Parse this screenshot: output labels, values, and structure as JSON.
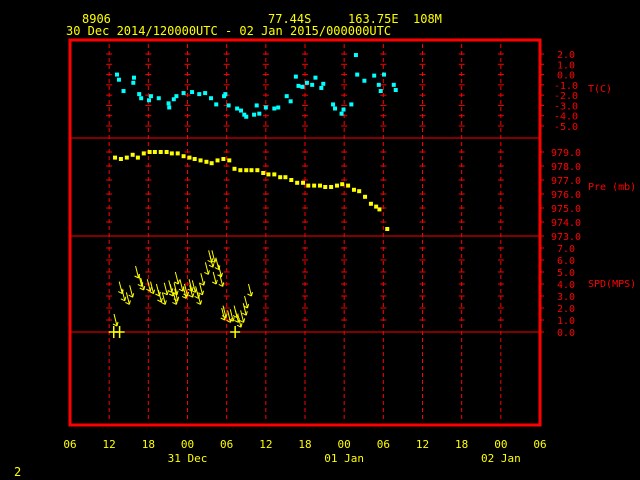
{
  "header": {
    "station_id": "8906",
    "latitude": "77.44S",
    "longitude": "163.75E",
    "elevation": "108M",
    "time_range": "30 Dec 2014/120000UTC - 02 Jan 2015/000000UTC"
  },
  "footer": {
    "page_number": "2"
  },
  "colors": {
    "frame": "#ff0000",
    "grid": "#ff0000",
    "axis_text": "#ffff00",
    "label_text": "#ff0000",
    "temperature": "#00ffff",
    "pressure": "#ffff00",
    "wind": "#ffff00"
  },
  "chart_data": {
    "type": "scatter",
    "x_axis": {
      "range_hours": [
        0,
        72
      ],
      "tick_labels": [
        "06",
        "12",
        "18",
        "00",
        "06",
        "12",
        "18",
        "00",
        "06",
        "12",
        "18",
        "00",
        "06"
      ],
      "date_labels": [
        {
          "text": "31 Dec",
          "at_hour": 18
        },
        {
          "text": "01 Jan",
          "at_hour": 42
        },
        {
          "text": "02 Jan",
          "at_hour": 66
        }
      ]
    },
    "panels": [
      {
        "name": "temperature",
        "label": "T(C)",
        "ylim": [
          -5.0,
          2.5
        ],
        "tick_labels": [
          "2.0",
          "1.0",
          "0.0",
          "-1.0",
          "-2.0",
          "-3.0",
          "-4.0",
          "-5.0"
        ],
        "tick_values": [
          2.0,
          1.0,
          0.0,
          -1.0,
          -2.0,
          -3.0,
          -4.0,
          -5.0
        ],
        "points": [
          [
            7.2,
            0.0
          ],
          [
            7.5,
            -0.5
          ],
          [
            8.2,
            -1.6
          ],
          [
            9.7,
            -0.8
          ],
          [
            9.8,
            -0.3
          ],
          [
            10.6,
            -1.9
          ],
          [
            10.9,
            -2.3
          ],
          [
            12.1,
            -2.5
          ],
          [
            12.4,
            -2.1
          ],
          [
            13.6,
            -2.3
          ],
          [
            15.1,
            -2.8
          ],
          [
            15.2,
            -3.2
          ],
          [
            15.9,
            -2.4
          ],
          [
            16.3,
            -2.1
          ],
          [
            17.4,
            -1.8
          ],
          [
            18.7,
            -1.7
          ],
          [
            19.8,
            -1.9
          ],
          [
            20.7,
            -1.8
          ],
          [
            21.6,
            -2.3
          ],
          [
            22.4,
            -2.9
          ],
          [
            23.6,
            -2.1
          ],
          [
            23.8,
            -1.9
          ],
          [
            24.3,
            -3.0
          ],
          [
            25.6,
            -3.3
          ],
          [
            26.2,
            -3.5
          ],
          [
            26.7,
            -3.9
          ],
          [
            27.0,
            -4.1
          ],
          [
            28.2,
            -3.9
          ],
          [
            28.6,
            -3.0
          ],
          [
            29.0,
            -3.8
          ],
          [
            30.0,
            -3.2
          ],
          [
            31.3,
            -3.3
          ],
          [
            31.9,
            -3.2
          ],
          [
            33.2,
            -2.1
          ],
          [
            33.8,
            -2.6
          ],
          [
            34.6,
            -0.2
          ],
          [
            35.0,
            -1.1
          ],
          [
            35.6,
            -1.2
          ],
          [
            36.3,
            -0.8
          ],
          [
            37.1,
            -1.0
          ],
          [
            37.6,
            -0.3
          ],
          [
            38.5,
            -1.3
          ],
          [
            38.8,
            -0.9
          ],
          [
            40.3,
            -2.9
          ],
          [
            40.6,
            -3.3
          ],
          [
            41.6,
            -3.8
          ],
          [
            41.9,
            -3.4
          ],
          [
            43.1,
            -2.9
          ],
          [
            43.8,
            1.9
          ],
          [
            44.0,
            0.0
          ],
          [
            45.1,
            -0.6
          ],
          [
            46.6,
            -0.1
          ],
          [
            47.3,
            -1.0
          ],
          [
            47.6,
            -1.6
          ],
          [
            48.1,
            0.0
          ],
          [
            49.6,
            -1.0
          ],
          [
            49.9,
            -1.5
          ]
        ]
      },
      {
        "name": "pressure",
        "label": "Pre (mb)",
        "ylim": [
          972.5,
          980.0
        ],
        "tick_labels": [
          "979.0",
          "978.0",
          "977.0",
          "976.0",
          "975.0",
          "974.0",
          "973.0"
        ],
        "tick_values": [
          979.0,
          978.0,
          977.0,
          976.0,
          975.0,
          974.0,
          973.0
        ],
        "points": [
          [
            6.9,
            978.6
          ],
          [
            7.8,
            978.5
          ],
          [
            8.7,
            978.6
          ],
          [
            9.6,
            978.8
          ],
          [
            10.4,
            978.6
          ],
          [
            11.3,
            978.9
          ],
          [
            12.2,
            979.0
          ],
          [
            13.0,
            979.0
          ],
          [
            13.9,
            979.0
          ],
          [
            14.8,
            979.0
          ],
          [
            15.6,
            978.9
          ],
          [
            16.5,
            978.9
          ],
          [
            17.4,
            978.7
          ],
          [
            18.3,
            978.6
          ],
          [
            19.1,
            978.5
          ],
          [
            20.0,
            978.4
          ],
          [
            20.9,
            978.3
          ],
          [
            21.7,
            978.2
          ],
          [
            22.6,
            978.4
          ],
          [
            23.5,
            978.5
          ],
          [
            24.4,
            978.4
          ],
          [
            25.2,
            977.8
          ],
          [
            26.1,
            977.7
          ],
          [
            27.0,
            977.7
          ],
          [
            27.8,
            977.7
          ],
          [
            28.7,
            977.7
          ],
          [
            29.6,
            977.5
          ],
          [
            30.4,
            977.4
          ],
          [
            31.3,
            977.4
          ],
          [
            32.2,
            977.2
          ],
          [
            33.0,
            977.2
          ],
          [
            33.9,
            977.0
          ],
          [
            34.8,
            976.8
          ],
          [
            35.7,
            976.8
          ],
          [
            36.5,
            976.6
          ],
          [
            37.4,
            976.6
          ],
          [
            38.3,
            976.6
          ],
          [
            39.1,
            976.5
          ],
          [
            40.0,
            976.5
          ],
          [
            40.9,
            976.6
          ],
          [
            41.7,
            976.7
          ],
          [
            42.6,
            976.6
          ],
          [
            43.5,
            976.3
          ],
          [
            44.3,
            976.2
          ],
          [
            45.2,
            975.8
          ],
          [
            46.1,
            975.3
          ],
          [
            46.9,
            975.1
          ],
          [
            47.4,
            974.9
          ],
          [
            48.6,
            973.5
          ]
        ]
      },
      {
        "name": "wind",
        "label": "SPD(MPS)",
        "ylim": [
          -0.5,
          7.5
        ],
        "tick_labels": [
          "7.0",
          "6.0",
          "5.0",
          "4.0",
          "3.0",
          "2.0",
          "1.0",
          "0.0"
        ],
        "tick_values": [
          7.0,
          6.0,
          5.0,
          4.0,
          3.0,
          2.0,
          1.0,
          0.0
        ],
        "points": [
          [
            6.7,
            0.0
          ],
          [
            7.2,
            0.5
          ],
          [
            7.6,
            0.0
          ],
          [
            8.0,
            3.2
          ],
          [
            8.4,
            2.6
          ],
          [
            9.1,
            2.3
          ],
          [
            9.6,
            2.9
          ],
          [
            10.5,
            4.5
          ],
          [
            11.0,
            3.8
          ],
          [
            11.3,
            3.5
          ],
          [
            12.3,
            3.4
          ],
          [
            12.8,
            3.2
          ],
          [
            13.7,
            3.0
          ],
          [
            14.0,
            2.5
          ],
          [
            14.6,
            2.3
          ],
          [
            14.9,
            3.1
          ],
          [
            15.6,
            3.3
          ],
          [
            15.8,
            3.0
          ],
          [
            16.3,
            2.3
          ],
          [
            16.4,
            3.1
          ],
          [
            16.5,
            2.6
          ],
          [
            16.6,
            4.0
          ],
          [
            17.3,
            3.4
          ],
          [
            17.8,
            2.8
          ],
          [
            18.0,
            3.0
          ],
          [
            18.7,
            3.4
          ],
          [
            18.8,
            2.9
          ],
          [
            19.2,
            3.3
          ],
          [
            19.7,
            2.8
          ],
          [
            20.0,
            2.3
          ],
          [
            20.3,
            3.1
          ],
          [
            20.5,
            3.9
          ],
          [
            21.2,
            4.8
          ],
          [
            21.7,
            5.8
          ],
          [
            21.9,
            5.4
          ],
          [
            22.2,
            5.8
          ],
          [
            22.4,
            4.0
          ],
          [
            22.8,
            5.2
          ],
          [
            23.2,
            4.6
          ],
          [
            23.4,
            3.8
          ],
          [
            23.7,
            1.0
          ],
          [
            23.9,
            1.2
          ],
          [
            24.6,
            0.8
          ],
          [
            25.0,
            0.9
          ],
          [
            25.3,
            0.0
          ],
          [
            25.6,
            1.2
          ],
          [
            25.8,
            0.8
          ],
          [
            26.2,
            0.4
          ],
          [
            26.6,
            0.8
          ],
          [
            27.0,
            1.4
          ],
          [
            27.2,
            2.0
          ],
          [
            27.8,
            3.0
          ]
        ]
      }
    ]
  }
}
